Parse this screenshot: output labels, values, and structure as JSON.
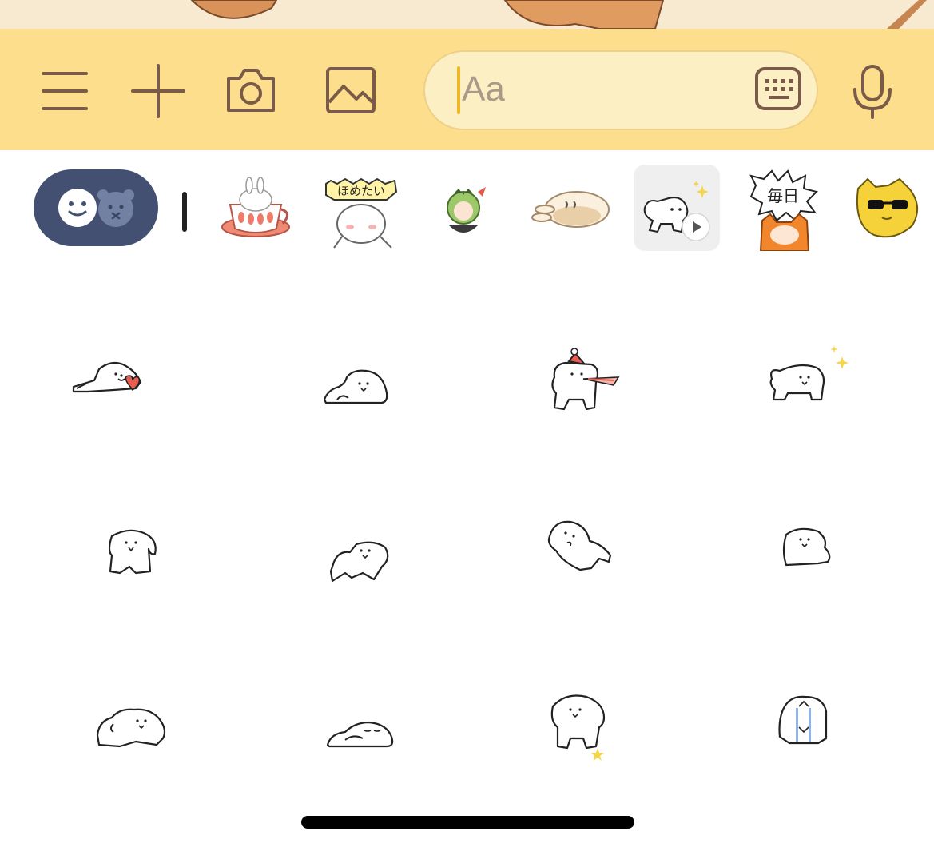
{
  "colors": {
    "toolbar_bg": "#fcde8c",
    "icon": "#7a5a48",
    "field_bg": "#fdefc4",
    "caret": "#f0b626",
    "toggle_bg": "#445071",
    "selected_tab_bg": "#efefef"
  },
  "toolbar": {
    "icons": [
      "menu-icon",
      "plus-icon",
      "camera-icon",
      "image-icon",
      "microphone-icon"
    ],
    "input": {
      "placeholder": "Aa",
      "value": "",
      "keyboard_icon": "keyboard-icon"
    }
  },
  "sticker_tray": {
    "toggle_icons": [
      "smiley-icon",
      "bear-icon"
    ],
    "packs": [
      {
        "icon": "bunny-teacup-sticker"
      },
      {
        "icon": "homeru-bunny-sticker",
        "text": "ほめたい"
      },
      {
        "icon": "green-hair-character-sticker"
      },
      {
        "icon": "lying-bunny-sticker"
      },
      {
        "icon": "animated-dog-sticker",
        "selected": true
      },
      {
        "icon": "mainichi-character-sticker",
        "text": "毎日"
      },
      {
        "icon": "sunglasses-cat-sticker"
      }
    ]
  },
  "sticker_grid": [
    "dog-lying-heart",
    "dog-lying-down",
    "dog-party-hat",
    "dog-sparkle",
    "dog-sitting",
    "dog-stretching",
    "dog-rolling",
    "dog-small-sitting",
    "dog-resting",
    "dog-sleeping",
    "dog-standing-star",
    "dog-crying"
  ]
}
